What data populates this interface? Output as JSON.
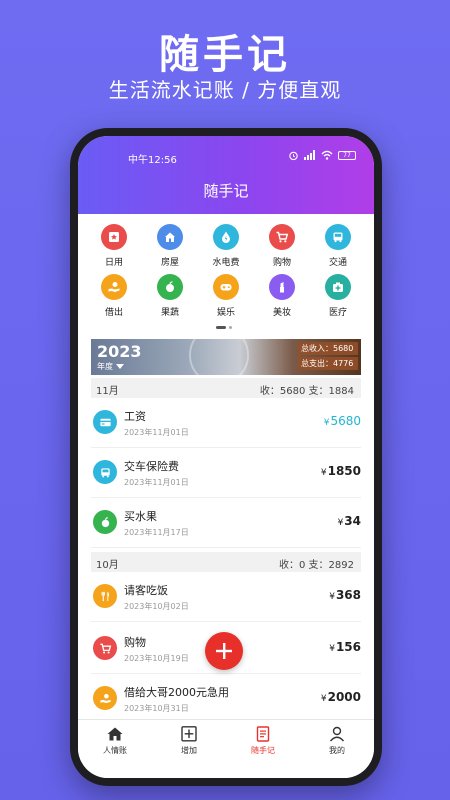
{
  "promo": {
    "title": "随手记",
    "subtitle": "生活流水记账 / 方便直观"
  },
  "status": {
    "time": "中午12:56",
    "battery": "77"
  },
  "app": {
    "title": "随手记"
  },
  "categories": [
    {
      "label": "日用",
      "icon": "star-icon",
      "color": "#ea4b4b"
    },
    {
      "label": "房屋",
      "icon": "house-icon",
      "color": "#4d8ce8"
    },
    {
      "label": "水电费",
      "icon": "drop-bolt-icon",
      "color": "#2eb6dc"
    },
    {
      "label": "购物",
      "icon": "cart-icon",
      "color": "#ea4b4b"
    },
    {
      "label": "交通",
      "icon": "bus-icon",
      "color": "#2eb6dc"
    },
    {
      "label": "借出",
      "icon": "hand-coin-icon",
      "color": "#f5a31b"
    },
    {
      "label": "果蔬",
      "icon": "apple-icon",
      "color": "#35b34f"
    },
    {
      "label": "娱乐",
      "icon": "gamepad-icon",
      "color": "#f5a31b"
    },
    {
      "label": "美妆",
      "icon": "lipstick-icon",
      "color": "#8b5cf0"
    },
    {
      "label": "医疗",
      "icon": "medkit-icon",
      "color": "#27b0a0"
    }
  ],
  "banner": {
    "year": "2023",
    "label": "年度",
    "income": "总收入：5680",
    "expense": "总支出：4776"
  },
  "months": [
    {
      "name": "11月",
      "summary": "收：5680    支：1884",
      "entries": [
        {
          "name": "工资",
          "date": "2023年11月01日",
          "amount": "5680",
          "yen": "¥",
          "icon": "card-icon",
          "color": "#2eb6dc"
        },
        {
          "name": "交车保险费",
          "date": "2023年11月01日",
          "amount": "1850",
          "yen": "¥",
          "icon": "bus-icon",
          "color": "#2eb6dc"
        },
        {
          "name": "买水果",
          "date": "2023年11月17日",
          "amount": "34",
          "yen": "¥",
          "icon": "apple-icon",
          "color": "#35b34f"
        }
      ]
    },
    {
      "name": "10月",
      "summary": "收：0    支：2892",
      "entries": [
        {
          "name": "请客吃饭",
          "date": "2023年10月02日",
          "amount": "368",
          "yen": "¥",
          "icon": "cutlery-icon",
          "color": "#f5a31b"
        },
        {
          "name": "购物",
          "date": "2023年10月19日",
          "amount": "156",
          "yen": "¥",
          "icon": "cart-icon",
          "color": "#ea4b4b"
        },
        {
          "name": "借给大哥2000元急用",
          "date": "2023年10月31日",
          "amount": "2000",
          "yen": "¥",
          "icon": "hand-coin-icon",
          "color": "#f5a31b"
        }
      ]
    }
  ],
  "tabs": [
    {
      "label": "人情账",
      "icon": "home-icon"
    },
    {
      "label": "增加",
      "icon": "plus-square-icon"
    },
    {
      "label": "随手记",
      "icon": "notebook-icon"
    },
    {
      "label": "我的",
      "icon": "user-icon"
    }
  ],
  "colors": {
    "accent": "#e8302b",
    "income": "#22b6d0",
    "header_start": "#6a5cf5",
    "header_end": "#b13ee8"
  }
}
